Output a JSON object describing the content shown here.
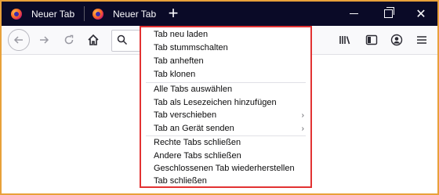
{
  "tabs": [
    {
      "label": "Neuer Tab"
    },
    {
      "label": "Neuer Tab"
    }
  ],
  "new_tab_symbol": "+",
  "window_controls": {
    "close_symbol": "✕"
  },
  "context_menu": {
    "groups": [
      [
        "Tab neu laden",
        "Tab stummschalten",
        "Tab anheften",
        "Tab klonen"
      ],
      [
        "Alle Tabs auswählen",
        "Tab als Lesezeichen hinzufügen",
        "Tab verschieben",
        "Tab an Gerät senden"
      ],
      [
        "Rechte Tabs schließen",
        "Andere Tabs schließen",
        "Geschlossenen Tab wiederherstellen",
        "Tab schließen"
      ]
    ],
    "items": {
      "reload": "Tab neu laden",
      "mute": "Tab stummschalten",
      "pin": "Tab anheften",
      "duplicate": "Tab klonen",
      "select_all": "Alle Tabs auswählen",
      "bookmark": "Tab als Lesezeichen hinzufügen",
      "move": "Tab verschieben",
      "send": "Tab an Gerät senden",
      "close_right": "Rechte Tabs schließen",
      "close_others": "Andere Tabs schließen",
      "restore": "Geschlossenen Tab wiederherstellen",
      "close": "Tab schließen"
    },
    "submenu_arrow": "›"
  },
  "icons": {
    "tab": "firefox-icon",
    "back": "back-arrow-icon",
    "forward": "forward-arrow-icon",
    "reload": "reload-icon",
    "home": "home-icon",
    "search": "search-icon",
    "library": "library-icon",
    "sidebar": "sidebar-icon",
    "account": "account-icon",
    "menu": "hamburger-menu-icon"
  },
  "colors": {
    "tabstrip": "#0a0a27",
    "toolbar": "#f9f9fb",
    "menu_highlight_border": "#e23232",
    "frame_border": "#e8a13a"
  }
}
